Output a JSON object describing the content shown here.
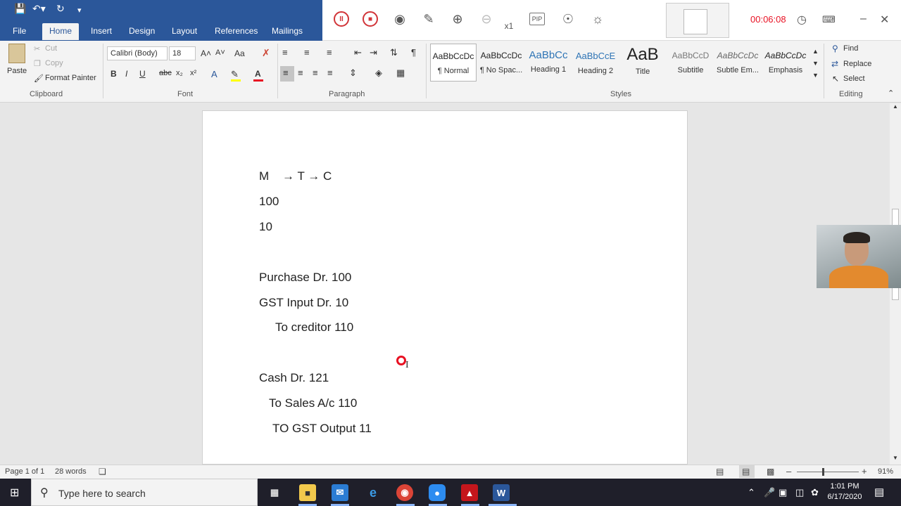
{
  "quick_access": {
    "save_icon": "save-icon",
    "undo_icon": "undo-icon",
    "redo_icon": "redo-icon",
    "customize_icon": "customize-qat-icon"
  },
  "ribbon_tabs": [
    "File",
    "Home",
    "Insert",
    "Design",
    "Layout",
    "References",
    "Mailings"
  ],
  "active_tab": "Home",
  "recorder": {
    "time": "00:06:08",
    "zoom_level": "x1",
    "pip_label": "PIP",
    "accent_color": "#d13438"
  },
  "clipboard": {
    "paste": "Paste",
    "cut": "Cut",
    "copy": "Copy",
    "format_painter": "Format Painter",
    "group": "Clipboard"
  },
  "font": {
    "family": "Calibri (Body)",
    "size": "18",
    "group": "Font",
    "bold": "B",
    "italic": "I",
    "underline": "U",
    "strike": "abc",
    "subscript": "x₂",
    "superscript": "x²",
    "grow": "A˄",
    "shrink": "A˅",
    "case": "Aa",
    "font_color": "#e81123",
    "highlight_color": "#ffff00"
  },
  "paragraph": {
    "group": "Paragraph",
    "pilcrow": "¶"
  },
  "styles": {
    "group": "Styles",
    "items": [
      {
        "sample": "AaBbCcDc",
        "name": "¶ Normal"
      },
      {
        "sample": "AaBbCcDc",
        "name": "¶ No Spac..."
      },
      {
        "sample": "AaBbCc",
        "name": "Heading 1"
      },
      {
        "sample": "AaBbCcE",
        "name": "Heading 2"
      },
      {
        "sample": "AaB",
        "name": "Title"
      },
      {
        "sample": "AaBbCcD",
        "name": "Subtitle"
      },
      {
        "sample": "AaBbCcDc",
        "name": "Subtle Em..."
      },
      {
        "sample": "AaBbCcDc",
        "name": "Emphasis"
      }
    ]
  },
  "editing": {
    "find": "Find",
    "replace": "Replace",
    "select": "Select",
    "group": "Editing"
  },
  "document": {
    "lines": [
      "M    → T → C",
      "100",
      "10",
      "Purchase Dr. 100",
      "GST Input Dr. 10",
      "To creditor 110",
      "Cash Dr. 121",
      "To Sales A/c 110",
      "TO GST Output 11"
    ]
  },
  "status": {
    "page": "Page 1 of 1",
    "words": "28 words",
    "zoom": "91%"
  },
  "taskbar": {
    "search_placeholder": "Type here to search",
    "time": "1:01 PM",
    "date": "6/17/2020",
    "apps": [
      "task-view",
      "file-explorer",
      "mail",
      "edge",
      "chrome",
      "screen-recorder",
      "acrobat",
      "word"
    ]
  }
}
